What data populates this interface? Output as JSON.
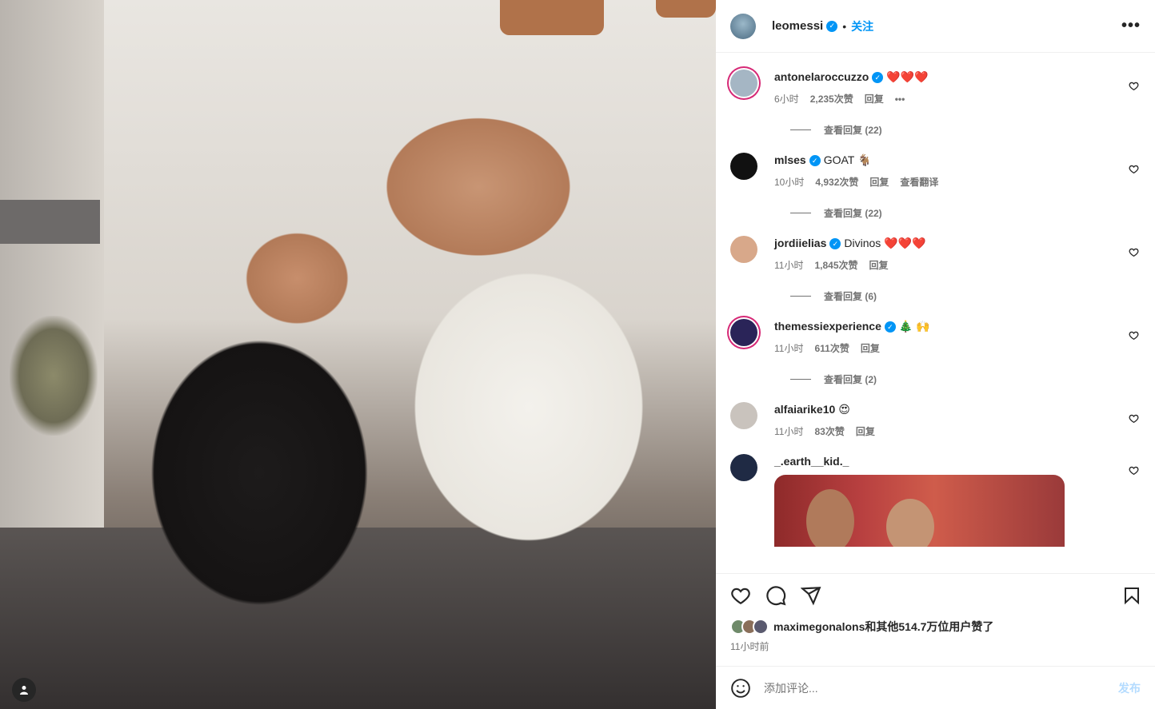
{
  "post": {
    "username": "leomessi",
    "follow_label": "关注",
    "more_icon": "more-horizontal-icon"
  },
  "comments": [
    {
      "user": "antonelaroccuzzo",
      "text": "❤️❤️❤️",
      "time": "6小时",
      "likes": "2,235次赞",
      "reply": "回复",
      "extra": "•••",
      "view_replies": "查看回复 (22)",
      "avatar_color": "#a5b6c4",
      "ring": true
    },
    {
      "user": "mlses",
      "text": "GOAT 🐐",
      "time": "10小时",
      "likes": "4,932次赞",
      "reply": "回复",
      "extra": "查看翻译",
      "view_replies": "查看回复 (22)",
      "avatar_color": "#111111",
      "ring": false
    },
    {
      "user": "jordiielias",
      "text": "Divinos ❤️❤️❤️",
      "time": "11小时",
      "likes": "1,845次赞",
      "reply": "回复",
      "extra": "",
      "view_replies": "查看回复 (6)",
      "avatar_color": "#d8a88a",
      "ring": false
    },
    {
      "user": "themessiexperience",
      "text": "🎄 🙌",
      "time": "11小时",
      "likes": "611次赞",
      "reply": "回复",
      "extra": "",
      "view_replies": "查看回复 (2)",
      "avatar_color": "#2a2458",
      "ring": true
    },
    {
      "user": "alfaiarike10",
      "text": "😍",
      "time": "11小时",
      "likes": "83次赞",
      "reply": "回复",
      "extra": "",
      "view_replies": "",
      "avatar_color": "#c9c3bd",
      "ring": false
    },
    {
      "user": "_.earth__kid._",
      "text": "",
      "time": "",
      "likes": "",
      "reply": "",
      "extra": "",
      "view_replies": "",
      "avatar_color": "#1f2a44",
      "ring": false
    }
  ],
  "actions": {
    "likes_user": "maximegonalons",
    "likes_rest": "和其他514.7万位用户赞了",
    "time_ago": "11小时前"
  },
  "comment_box": {
    "placeholder": "添加评论...",
    "post_label": "发布"
  },
  "colors": {
    "accent": "#0095f6",
    "text": "#262626",
    "muted": "#737373",
    "border": "#efefef"
  }
}
